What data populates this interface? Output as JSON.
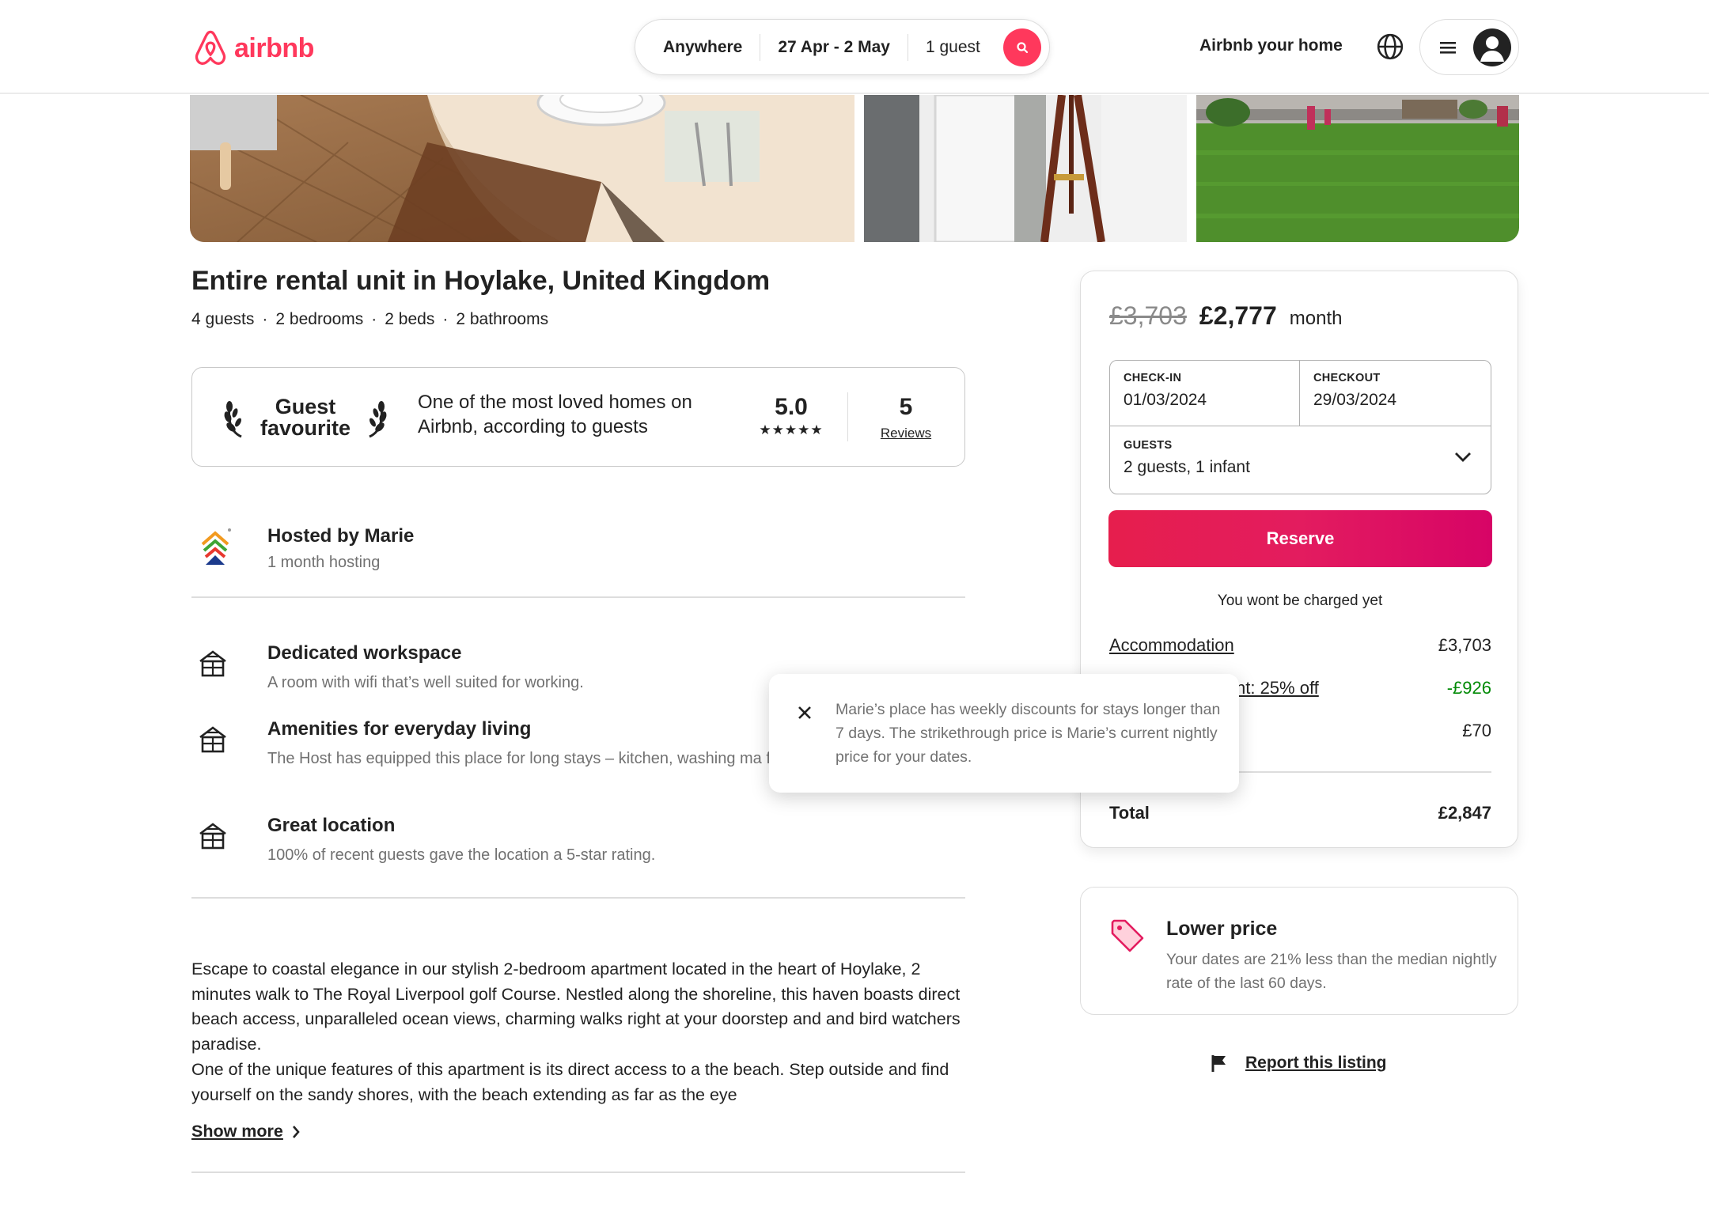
{
  "header": {
    "logo_text": "airbnb",
    "search": {
      "location": "Anywhere",
      "dates": "27 Apr - 2 May",
      "guests": "1 guest"
    },
    "host_link": "Airbnb your home",
    "brand_color": "#ff385c"
  },
  "listing": {
    "title": "Entire rental unit in Hoylake, United Kingdom",
    "specs": [
      "4 guests",
      "2 bedrooms",
      "2 beds",
      "2 bathrooms"
    ],
    "guest_favourite": {
      "badge_line1": "Guest",
      "badge_line2": "favourite",
      "description": "One of the most loved homes on Airbnb, according to guests",
      "rating": "5.0",
      "stars": "★★★★★",
      "reviews_count": "5",
      "reviews_label": "Reviews"
    },
    "host": {
      "name": "Hosted by Marie",
      "duration": "1 month hosting"
    },
    "features": [
      {
        "title": "Dedicated workspace",
        "description": "A room with wifi that’s well suited for working.",
        "icon": "building-icon"
      },
      {
        "title": "Amenities for everyday living",
        "description": "The Host has equipped this place for long stays – kitchen, washing ma free parking included.",
        "icon": "building-icon"
      },
      {
        "title": "Great location",
        "description": "100% of recent guests gave the location a 5-star rating.",
        "icon": "building-icon"
      }
    ],
    "description_lines": [
      "Escape to coastal elegance in our stylish 2-bedroom apartment located in the heart of Hoylake, 2 minutes walk to The Royal Liverpool golf Course. Nestled along the shoreline, this haven boasts direct beach access, unparalleled ocean views, charming walks right at your doorstep and and bird watchers paradise.",
      "One of the unique features of this apartment is its direct access to a the  beach. Step outside and find yourself on the sandy shores, with the beach extending as far as the eye"
    ],
    "show_more": "Show more"
  },
  "booking": {
    "price_old": "£3,703",
    "price_new": "£2,777",
    "price_unit": "month",
    "checkin_label": "CHECK-IN",
    "checkin_value": "01/03/2024",
    "checkout_label": "CHECKOUT",
    "checkout_value": "29/03/2024",
    "guests_label": "GUESTS",
    "guests_value": "2 guests, 1 infant",
    "reserve_label": "Reserve",
    "no_charge_note": "You wont be charged yet",
    "line_items": [
      {
        "label": "Accommodation",
        "value": "£3,703"
      },
      {
        "label": "nt: 25% off",
        "value": "-£926"
      },
      {
        "label": "",
        "value": "£70"
      }
    ],
    "total_label": "Total",
    "total_value": "£2,847"
  },
  "tooltip": {
    "text": "Marie’s place has weekly discounts for stays longer than 7 days. The strikethrough price is Marie’s current nightly price for your dates."
  },
  "lower_price": {
    "title": "Lower price",
    "description": "Your dates are 21% less than the median nightly rate of the last 60 days."
  },
  "report": {
    "label": "Report this listing"
  }
}
